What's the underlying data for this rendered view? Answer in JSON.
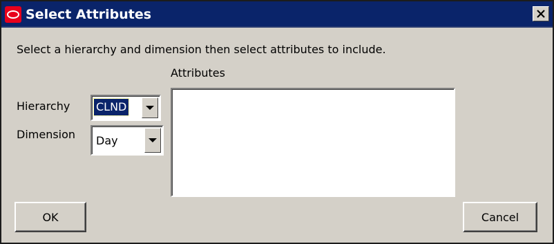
{
  "window": {
    "title": "Select Attributes",
    "app_icon": "oracle-logo-icon",
    "close_icon": "close-icon"
  },
  "instructions": "Select a hierarchy and dimension then select attributes to include.",
  "attributes": {
    "label": "Attributes",
    "items": []
  },
  "hierarchy": {
    "label": "Hierarchy",
    "value": "CLND"
  },
  "dimension": {
    "label": "Dimension",
    "value": "Day"
  },
  "buttons": {
    "ok": "OK",
    "cancel": "Cancel"
  },
  "colors": {
    "titlebar": "#0a246a",
    "dialog_bg": "#d4d0c8",
    "selection": "#0a246a",
    "app_icon": "#e8001c"
  }
}
